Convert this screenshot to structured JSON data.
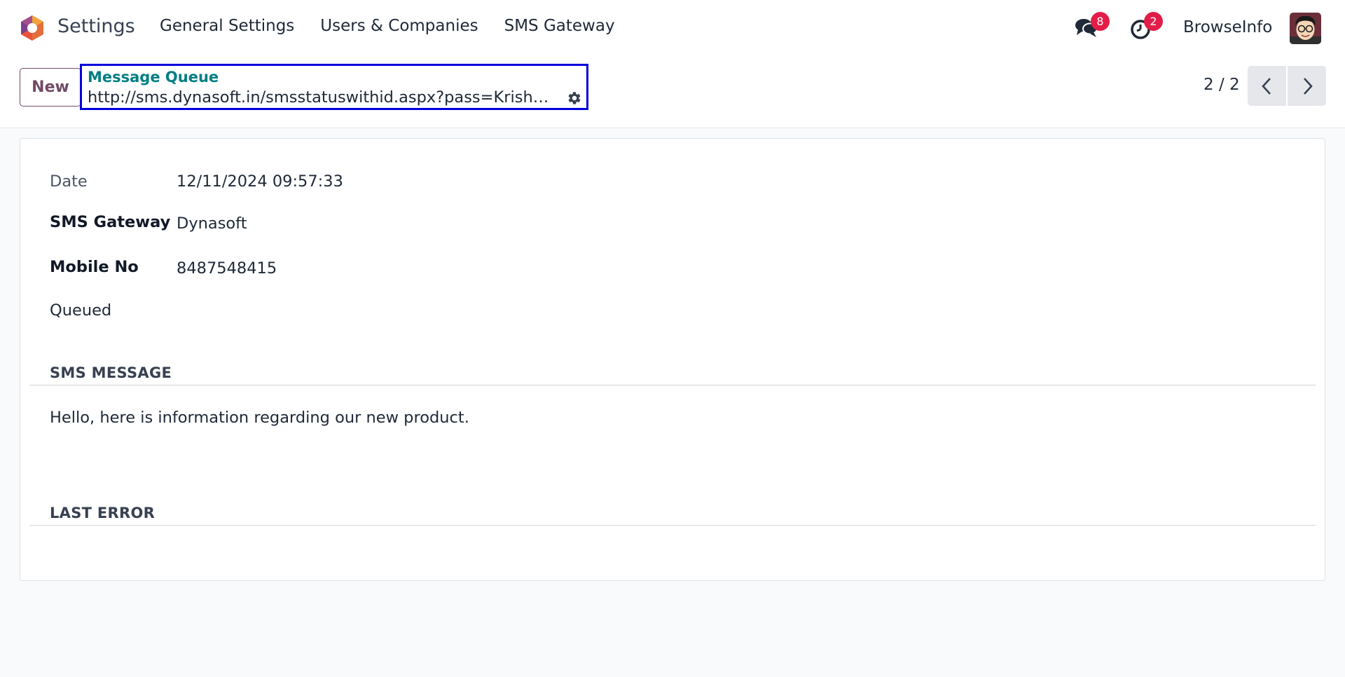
{
  "navbar": {
    "app_name": "Settings",
    "menu": [
      "General Settings",
      "Users & Companies",
      "SMS Gateway"
    ],
    "messages_count": "8",
    "activities_count": "2",
    "company": "BrowseInfo"
  },
  "control_panel": {
    "new_label": "New",
    "breadcrumb_parent": "Message Queue",
    "breadcrumb_current": "http://sms.dynasoft.in/smsstatuswithid.aspx?pass=Krishna…",
    "pager": "2 / 2"
  },
  "form": {
    "date_label": "Date",
    "date_value": "12/11/2024 09:57:33",
    "gateway_label": "SMS Gateway",
    "gateway_value": "Dynasoft",
    "mobile_label": "Mobile No",
    "mobile_value": "8487548415",
    "status": "Queued",
    "sms_section": "SMS MESSAGE",
    "sms_text": "Hello, here is information regarding our new product.",
    "error_section": "LAST ERROR"
  },
  "colors": {
    "accent": "#714b67",
    "link": "#017e84",
    "badge": "#e11d48",
    "highlight_box": "#0000dd"
  },
  "icons": [
    "odoo-logo-icon",
    "chat-bubbles-icon",
    "clock-icon",
    "gear-icon",
    "chevron-left-icon",
    "chevron-right-icon"
  ]
}
